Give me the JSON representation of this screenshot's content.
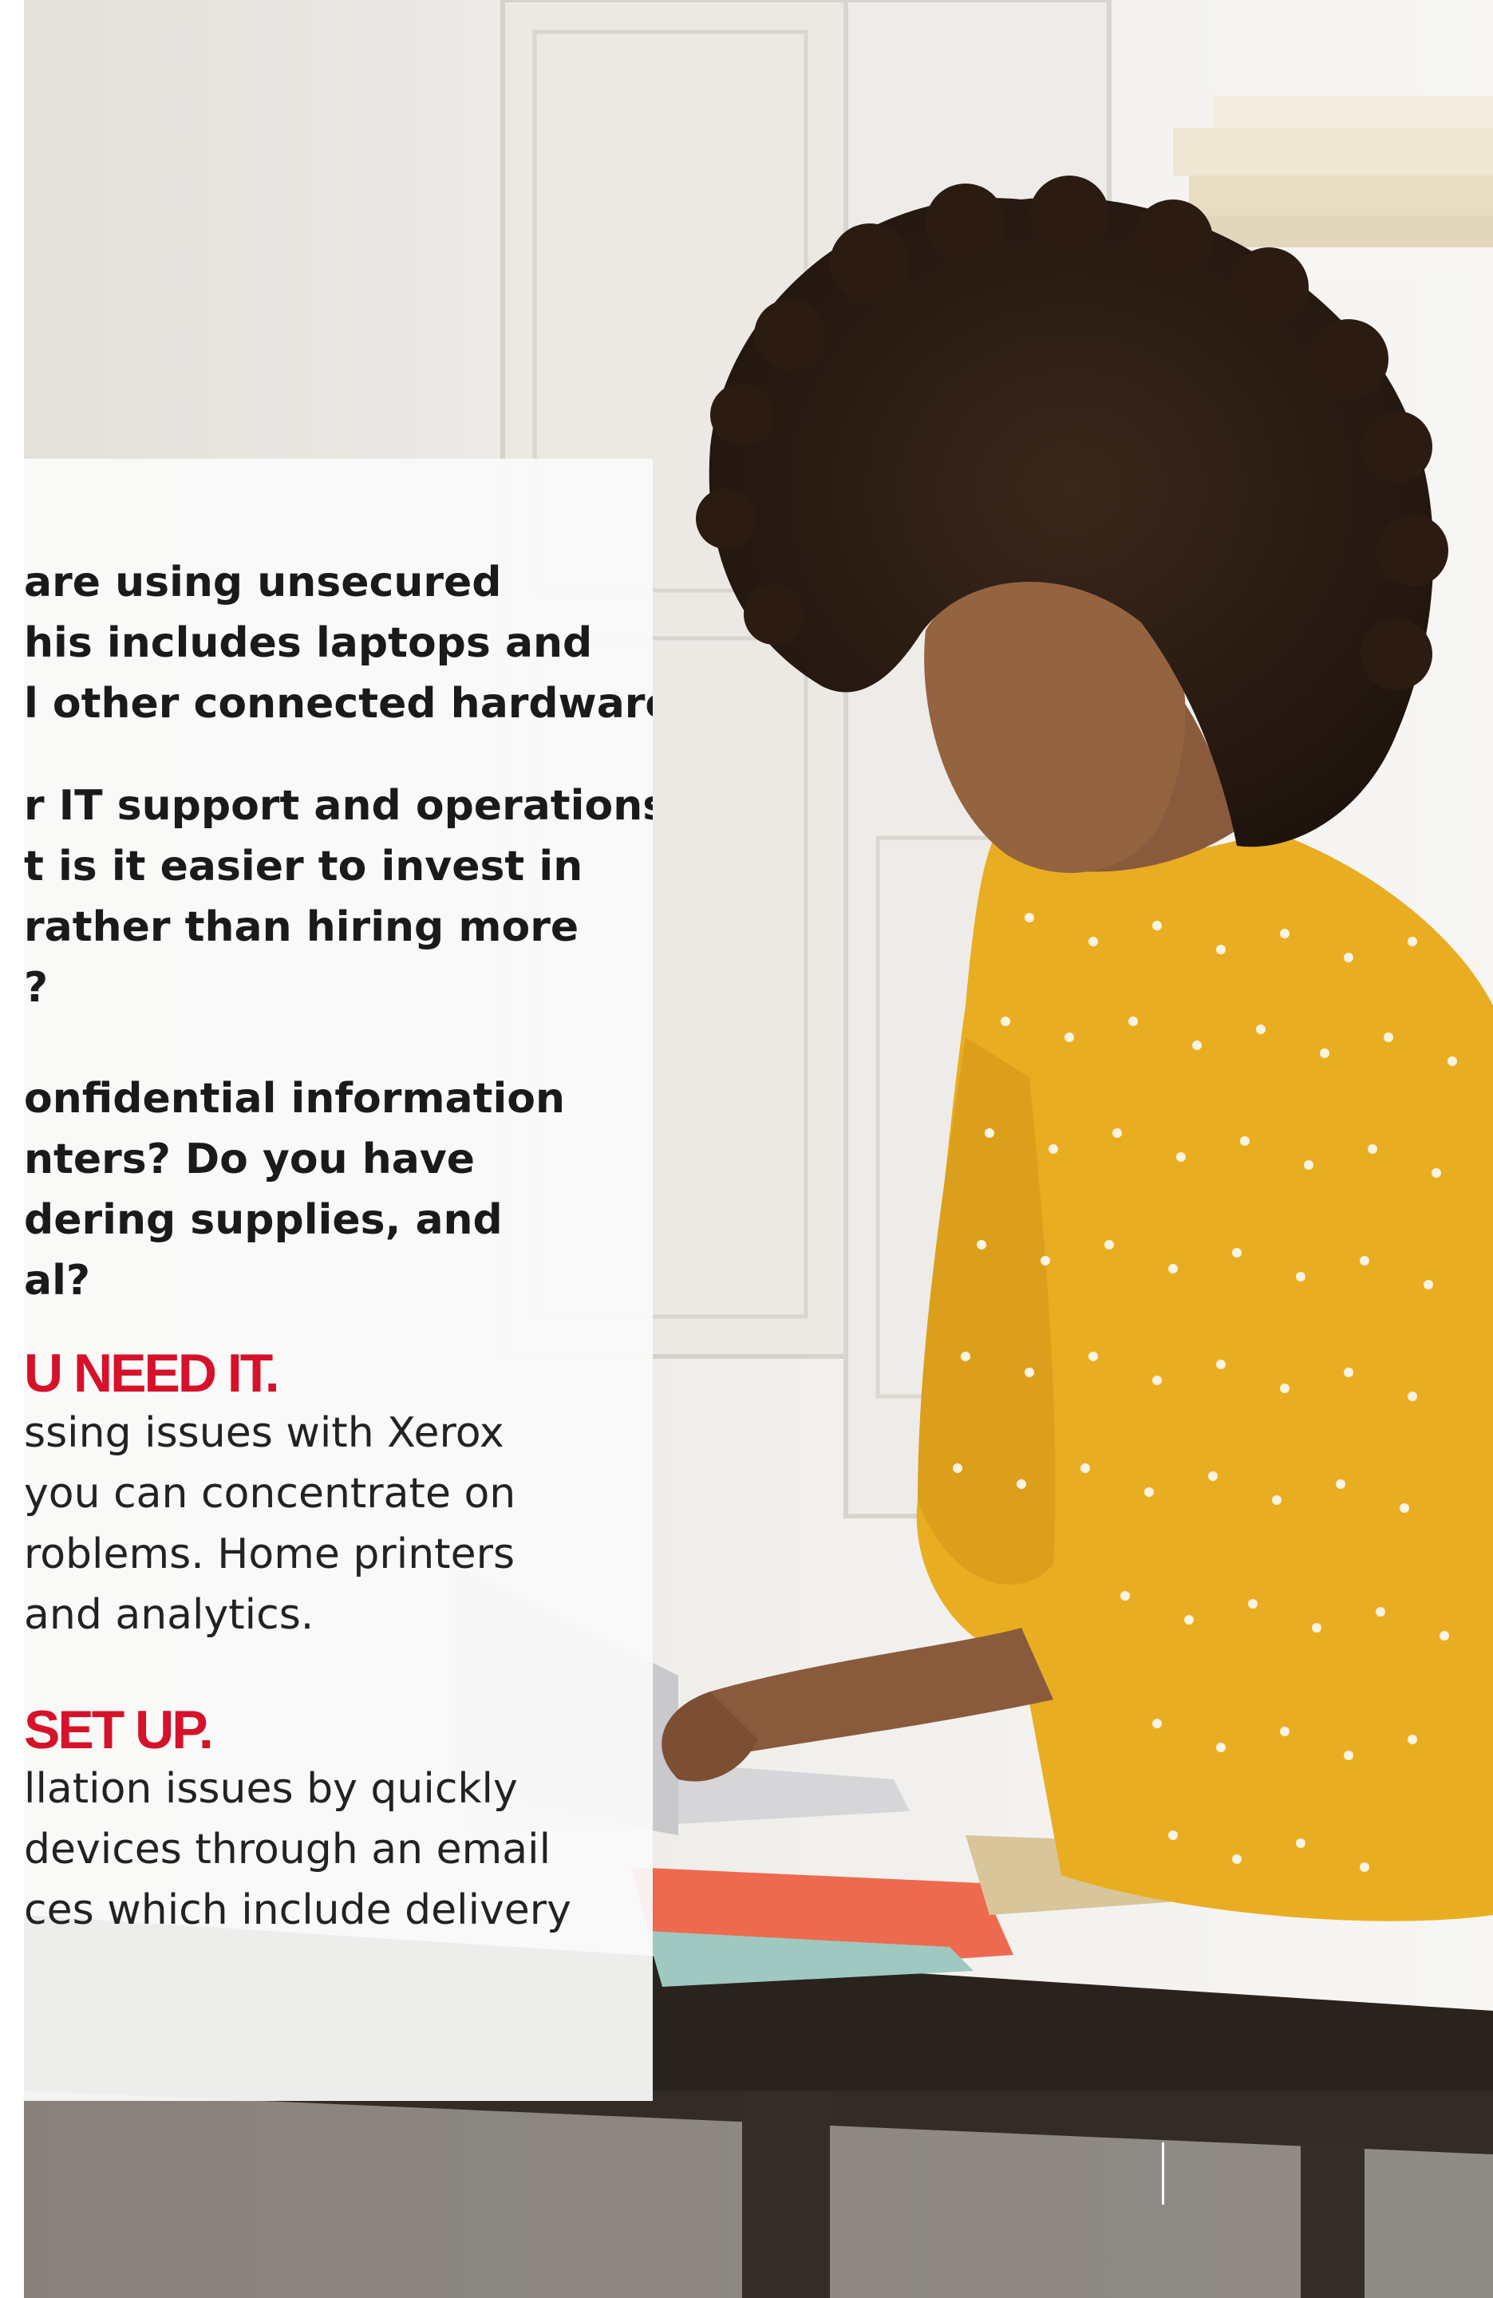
{
  "questions": [
    {
      "lines": [
        "are using unsecured",
        "his includes laptops and",
        "l other connected hardware."
      ]
    },
    {
      "lines": [
        "r IT support and operations",
        "t is it easier to invest in",
        "rather than hiring more",
        "?"
      ]
    },
    {
      "lines": [
        "onfidential information",
        "nters? Do you have",
        "dering supplies, and",
        "al?"
      ]
    }
  ],
  "sections": [
    {
      "heading": "U NEED IT.",
      "lines": [
        "ssing issues with Xerox",
        "you can concentrate on",
        "roblems. Home printers",
        "and analytics."
      ]
    },
    {
      "heading": "SET UP.",
      "lines": [
        "llation issues by quickly",
        "devices through an email",
        "ces which include delivery"
      ]
    }
  ],
  "colors": {
    "accent": "#d6112a",
    "text": "#1a1a1a",
    "overlay": "#fafafa",
    "shirt": "#e9ad22"
  }
}
